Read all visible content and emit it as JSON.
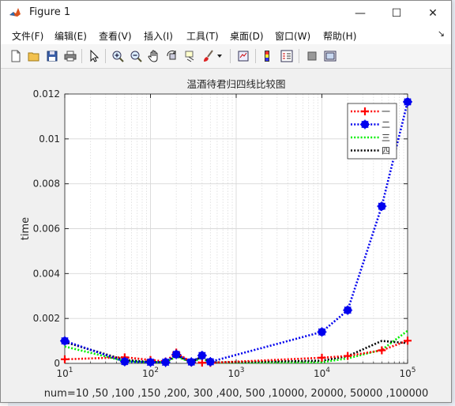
{
  "window": {
    "title": "Figure 1",
    "minimize": "—",
    "maximize": "☐",
    "close": "✕"
  },
  "menu": [
    {
      "label": "文件(F)"
    },
    {
      "label": "编辑(E)"
    },
    {
      "label": "查看(V)"
    },
    {
      "label": "插入(I)"
    },
    {
      "label": "工具(T)"
    },
    {
      "label": "桌面(D)"
    },
    {
      "label": "窗口(W)"
    },
    {
      "label": "帮助(H)"
    }
  ],
  "toolbar_icons": [
    "new-figure-icon",
    "open-file-icon",
    "save-icon",
    "print-icon",
    "edit-plot-icon",
    "zoom-in-icon",
    "zoom-out-icon",
    "pan-icon",
    "rotate-3d-icon",
    "data-cursor-icon",
    "brush-icon",
    "brush-menu-icon",
    "link-plot-icon",
    "colorbar-icon",
    "legend-icon",
    "hide-plot-tools-icon",
    "show-plot-tools-icon"
  ],
  "edge_chars": [
    "ir",
    "e",
    "e"
  ],
  "chart_data": {
    "type": "line",
    "title": "温酒待君归四线比较图",
    "xlabel": "num=10 ,50 ,100 ,150 ,200, 300 ,400, 500 ,10000, 20000, 50000 ,100000",
    "ylabel": "time",
    "x_scale": "log",
    "xlim": [
      10,
      100000
    ],
    "ylim": [
      0,
      0.012
    ],
    "grid": true,
    "legend_position": "top-right",
    "x_ticks": [
      {
        "value": 10,
        "base": "10",
        "exp": "1"
      },
      {
        "value": 100,
        "base": "10",
        "exp": "2"
      },
      {
        "value": 1000,
        "base": "10",
        "exp": "3"
      },
      {
        "value": 10000,
        "base": "10",
        "exp": "4"
      },
      {
        "value": 100000,
        "base": "10",
        "exp": "5"
      }
    ],
    "y_ticks": [
      {
        "value": 0,
        "label": "0"
      },
      {
        "value": 0.002,
        "label": "0.002"
      },
      {
        "value": 0.004,
        "label": "0.004"
      },
      {
        "value": 0.006,
        "label": "0.006"
      },
      {
        "value": 0.008,
        "label": "0.008"
      },
      {
        "value": 0.01,
        "label": "0.01"
      },
      {
        "value": 0.012,
        "label": "0.012"
      }
    ],
    "x": [
      10,
      50,
      100,
      150,
      200,
      300,
      400,
      500,
      10000,
      20000,
      50000,
      100000
    ],
    "series": [
      {
        "name": "一",
        "color": "#ff0000",
        "marker": "plus",
        "values": [
          0.00018,
          0.00027,
          0.00015,
          8e-05,
          0.00048,
          5e-05,
          3e-05,
          2e-05,
          0.00025,
          0.00033,
          0.00058,
          0.00101
        ]
      },
      {
        "name": "二",
        "color": "#0000ee",
        "marker": "star",
        "values": [
          0.001,
          8e-05,
          5e-05,
          5e-05,
          0.0004,
          6e-05,
          0.00035,
          7e-05,
          0.0014,
          0.00237,
          0.007,
          0.01165
        ]
      },
      {
        "name": "三",
        "color": "#00ee00",
        "marker": "none",
        "values": [
          0.00075,
          0.0001,
          5e-05,
          5e-05,
          0.0003,
          5e-05,
          0.00025,
          3e-05,
          5e-05,
          0.00022,
          0.0006,
          0.00145
        ]
      },
      {
        "name": "四",
        "color": "#000000",
        "marker": "none",
        "values": [
          0.00095,
          0.00015,
          6e-05,
          5e-05,
          0.00035,
          6e-05,
          0.0003,
          4e-05,
          0.00012,
          0.00032,
          0.001,
          0.0009
        ]
      }
    ]
  }
}
